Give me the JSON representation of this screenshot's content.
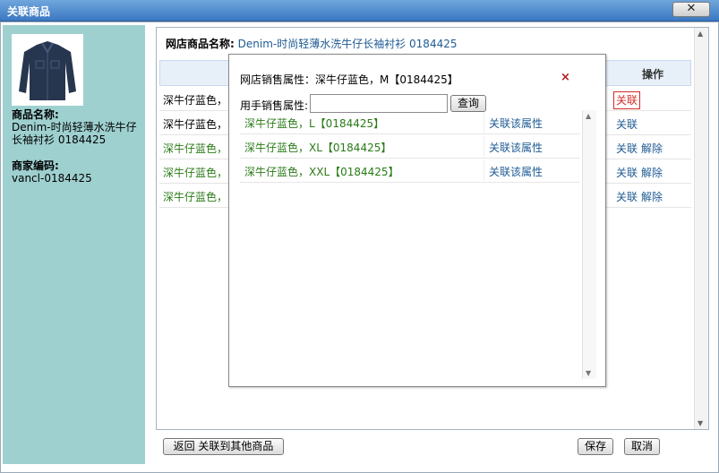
{
  "window": {
    "title": "关联商品",
    "close_icon": "close-icon"
  },
  "sidebar": {
    "name_label": "商品名称:",
    "name_value": "Denim-时尚轻薄水洗牛仔长袖衬衫 0184425",
    "merchant_label": "商家编码:",
    "merchant_value": "vancl-0184425",
    "thumbnail": "shirt-thumbnail"
  },
  "main": {
    "store_label": "网店商品名称:",
    "store_value": "Denim-时尚轻薄水洗牛仔长袖衬衫 0184425",
    "col_ops": "操作",
    "rows": [
      {
        "attr": "深牛仔蓝色，",
        "link": "关联",
        "unlink": ""
      },
      {
        "attr": "深牛仔蓝色，",
        "link": "关联",
        "unlink": ""
      },
      {
        "attr": "深牛仔蓝色，",
        "link": "关联",
        "unlink": "解除"
      },
      {
        "attr": "深牛仔蓝色，",
        "link": "关联",
        "unlink": "解除"
      },
      {
        "attr": "深牛仔蓝色，",
        "link": "关联",
        "unlink": "解除"
      }
    ]
  },
  "popup": {
    "title": "网店销售属性：深牛仔蓝色，M【0184425】",
    "close": "×",
    "search_label": "用手销售属性:",
    "search_value": "",
    "search_button": "查询",
    "items": [
      {
        "attr": "深牛仔蓝色，L【0184425】",
        "action": "关联该属性"
      },
      {
        "attr": "深牛仔蓝色，XL【0184425】",
        "action": "关联该属性"
      },
      {
        "attr": "深牛仔蓝色，XXL【0184425】",
        "action": "关联该属性"
      }
    ]
  },
  "footer": {
    "back_button": "返回 关联到其他商品",
    "save_button": "保存",
    "cancel_button": "取消"
  }
}
